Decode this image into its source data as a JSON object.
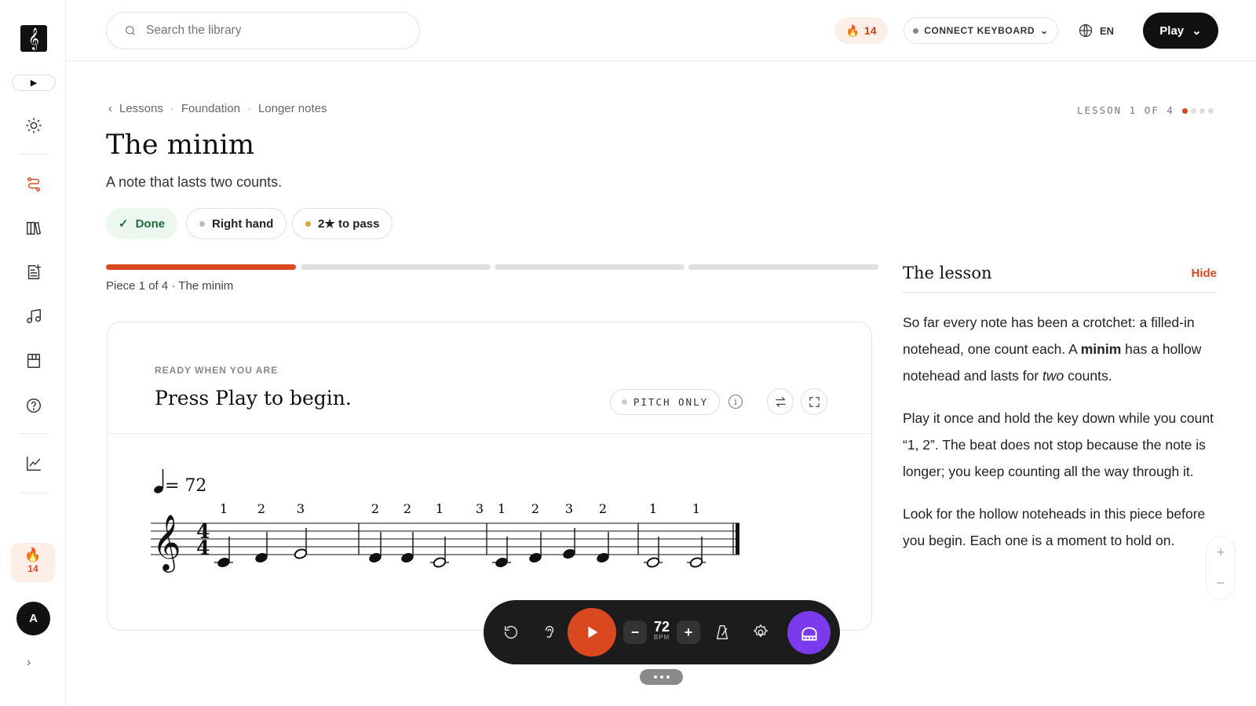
{
  "sidebar": {
    "logo": "𝄞",
    "streak_count": "14",
    "avatar_initial": "A",
    "items": [
      {
        "name": "sun-icon"
      },
      {
        "name": "route-icon"
      },
      {
        "name": "library-icon"
      },
      {
        "name": "sheet-add-icon"
      },
      {
        "name": "music-note-icon"
      },
      {
        "name": "book-icon"
      },
      {
        "name": "help-icon"
      },
      {
        "name": "chart-icon"
      }
    ]
  },
  "topbar": {
    "search_placeholder": "Search the library",
    "streak": "14",
    "connect_label": "CONNECT KEYBOARD",
    "language": "EN",
    "play_label": "Play"
  },
  "breadcrumb": {
    "items": [
      "Lessons",
      "Foundation",
      "Longer notes"
    ],
    "separator": "·"
  },
  "lesson_counter": "LESSON 1 OF 4",
  "lesson_dots": {
    "total": 4,
    "current": 1
  },
  "lesson": {
    "title": "The minim",
    "subtitle": "A note that lasts two counts.",
    "chips": {
      "done": "Done",
      "hand": "Right hand",
      "pass": "2★ to pass"
    },
    "progress": {
      "total": 4,
      "current": 1
    },
    "piece_label": "Piece 1 of 4 · The minim"
  },
  "player": {
    "ready_label": "READY WHEN YOU ARE",
    "prompt": "Press Play to begin.",
    "mode_label": "PITCH ONLY",
    "info_glyph": "i",
    "tempo_marking": "= 72",
    "time_signature": [
      "4",
      "4"
    ],
    "fingering": [
      "1",
      "2",
      "3",
      "2",
      "2",
      "1",
      "3",
      "1",
      "2",
      "3",
      "2",
      "1",
      "1"
    ]
  },
  "controls": {
    "bpm": "72",
    "bpm_unit": "BPM",
    "minus": "−",
    "plus": "+"
  },
  "lesson_panel": {
    "title": "The lesson",
    "hide_label": "Hide",
    "p1_a": "So far every note has been a crotchet: a filled-in notehead, one count each. A ",
    "p1_b": "minim",
    "p1_c": " has a hollow notehead and lasts for ",
    "p1_d": "two",
    "p1_e": " counts.",
    "p2": "Play it once and hold the key down while you count “1, 2”. The beat does not stop because the note is longer; you keep counting all the way through it.",
    "p3": "Look for the hollow noteheads in this piece before you begin. Each one is a moment to hold on."
  },
  "zoom": {
    "plus": "+",
    "minus": "−"
  },
  "colors": {
    "accent": "#d9481f",
    "keyboard": "#7c3aed",
    "done_bg": "#ecf7ef"
  }
}
